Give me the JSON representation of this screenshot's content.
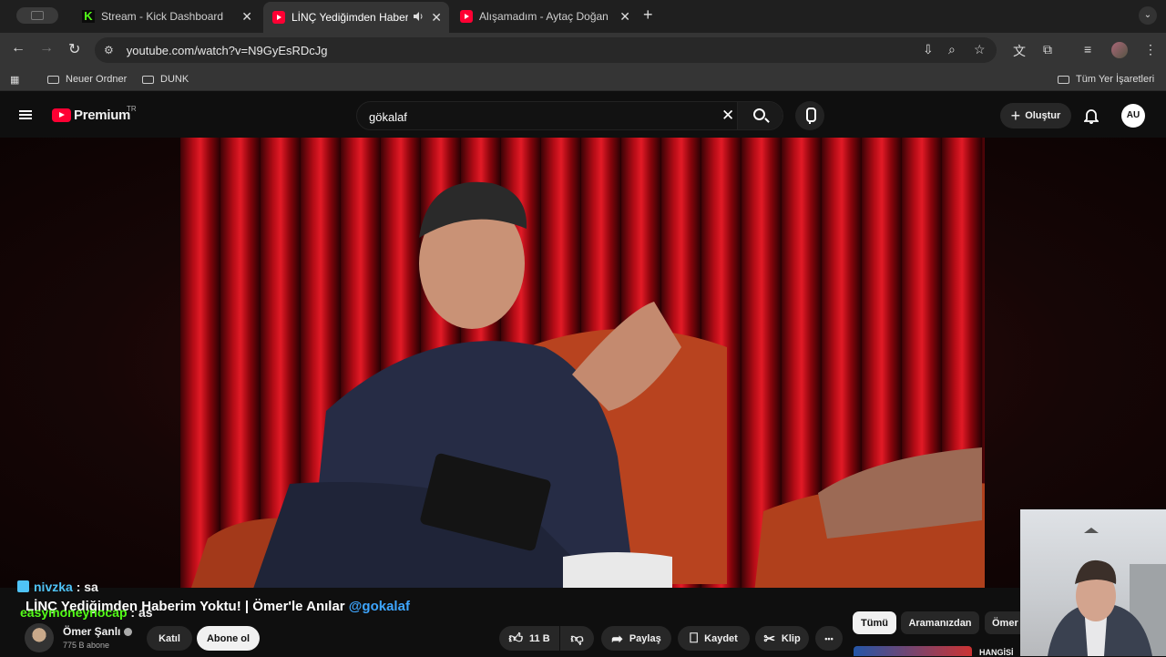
{
  "browser": {
    "tabs": [
      {
        "title": "Stream - Kick Dashboard",
        "favicon": "kick-icon"
      },
      {
        "title": "LİNÇ Yediğimden Haberim",
        "favicon": "youtube-icon",
        "active": true,
        "audio": true
      },
      {
        "title": "Alışamadım - Aytaç Doğan Ka",
        "favicon": "youtube-icon"
      }
    ],
    "close_glyph": "✕",
    "newtab_glyph": "+",
    "url": "youtube.com/watch?v=N9GyEsRDcJg",
    "bookmarks": [
      "Neuer Ordner",
      "DUNK"
    ],
    "all_bookmarks": "Tüm Yer İşaretleri"
  },
  "youtube": {
    "brand": "Premium",
    "region": "TR",
    "search_query": "gökalaf",
    "create_label": "Oluştur",
    "avatar_initials": "AU"
  },
  "chat_overlay": [
    {
      "user": "nivzka",
      "message": " : sa",
      "user_color": "#4fc3f7"
    },
    {
      "user": "easymoneynocap",
      "message": " : as",
      "user_color": "#53fc18"
    }
  ],
  "video": {
    "title_text": "LİNÇ Yediğimden Haberim Yoktu! | Ömer'le Anılar ",
    "title_mention": "@gokalaf",
    "channel_name": "Ömer Şanlı",
    "subscribers": "775 B abone",
    "join_label": "Katıl",
    "subscribe_label": "Abone ol",
    "likes": "11 B",
    "share_label": "Paylaş",
    "save_label": "Kaydet",
    "clip_label": "Klip",
    "more_label": "•••"
  },
  "filter_chips": [
    "Tümü",
    "Aramanızdan",
    "Ömer"
  ],
  "recommendation_title": "HANGİSİ",
  "colors": {
    "accent": "#ff0033",
    "link": "#3ea6ff"
  }
}
